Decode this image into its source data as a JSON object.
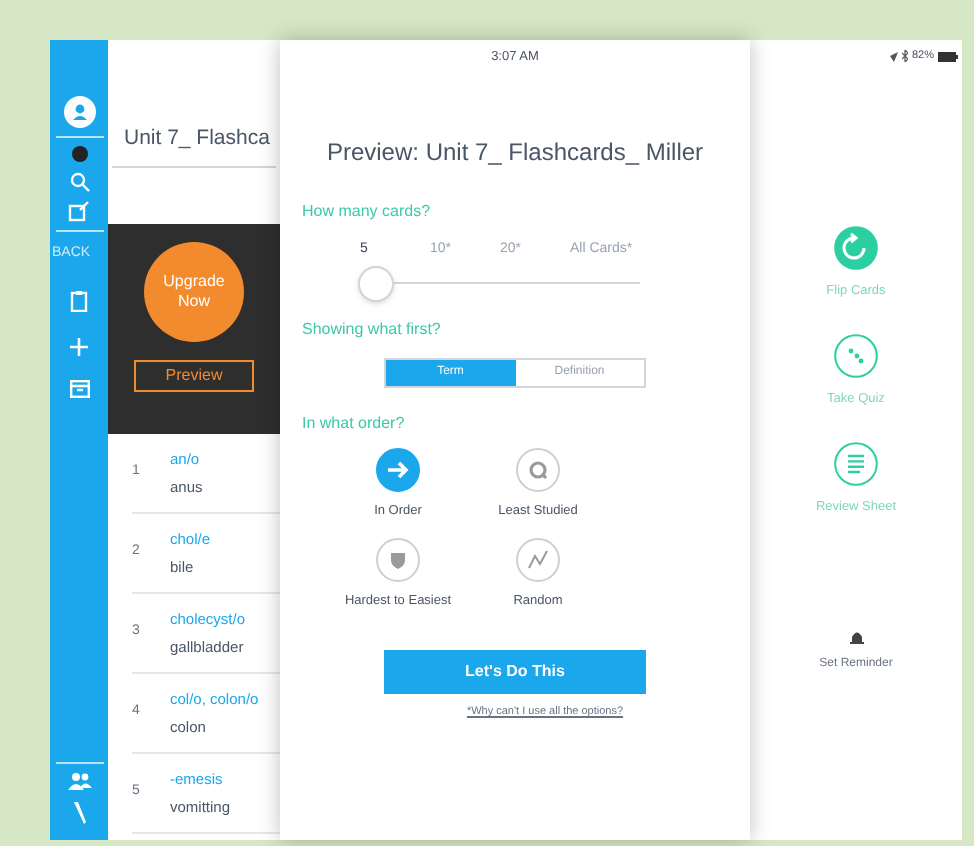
{
  "sidebar": {
    "back_label": "BACK"
  },
  "set": {
    "title": "Unit 7_ Flashca",
    "upgrade": "Upgrade Now",
    "preview": "Preview",
    "terms": [
      {
        "number": "1",
        "term": "an/o",
        "definition": "anus"
      },
      {
        "number": "2",
        "term": "chol/e",
        "definition": "bile"
      },
      {
        "number": "3",
        "term": "cholecyst/o",
        "definition": "gallbladder"
      },
      {
        "number": "4",
        "term": "col/o, colon/o",
        "definition": "colon"
      },
      {
        "number": "5",
        "term": "-emesis",
        "definition": "vomitting"
      }
    ]
  },
  "dialog": {
    "time": "3:07 AM",
    "title": "Preview: Unit 7_ Flashcards_ Miller",
    "cards_label": "How many cards?",
    "card_options": [
      {
        "label": "5",
        "selected": true
      },
      {
        "label": "10*",
        "selected": false
      },
      {
        "label": "20*",
        "selected": false
      },
      {
        "label": "All Cards*",
        "selected": false
      }
    ],
    "first_label": "Showing what first?",
    "first_options": [
      {
        "label": "Term",
        "selected": true
      },
      {
        "label": "Definition",
        "selected": false
      }
    ],
    "order_label": "In what order?",
    "order_options": [
      {
        "kind": "arrow",
        "label": "In Order",
        "selected": true
      },
      {
        "kind": "cycle",
        "label": "Least Studied",
        "selected": false
      },
      {
        "kind": "shield",
        "label": "Hardest to Easiest",
        "selected": false
      },
      {
        "kind": "zigzag",
        "label": "Random",
        "selected": false
      }
    ],
    "start": "Let's Do This",
    "note": "*Why can't I use all the options?"
  },
  "status": {
    "battery": "82%"
  },
  "actions": [
    {
      "kind": "flip",
      "label": "Flip Cards",
      "selected": true
    },
    {
      "kind": "quiz",
      "label": "Take Quiz",
      "selected": false
    },
    {
      "kind": "sheet",
      "label": "Review Sheet",
      "selected": false
    }
  ],
  "reminder": "Set Reminder"
}
